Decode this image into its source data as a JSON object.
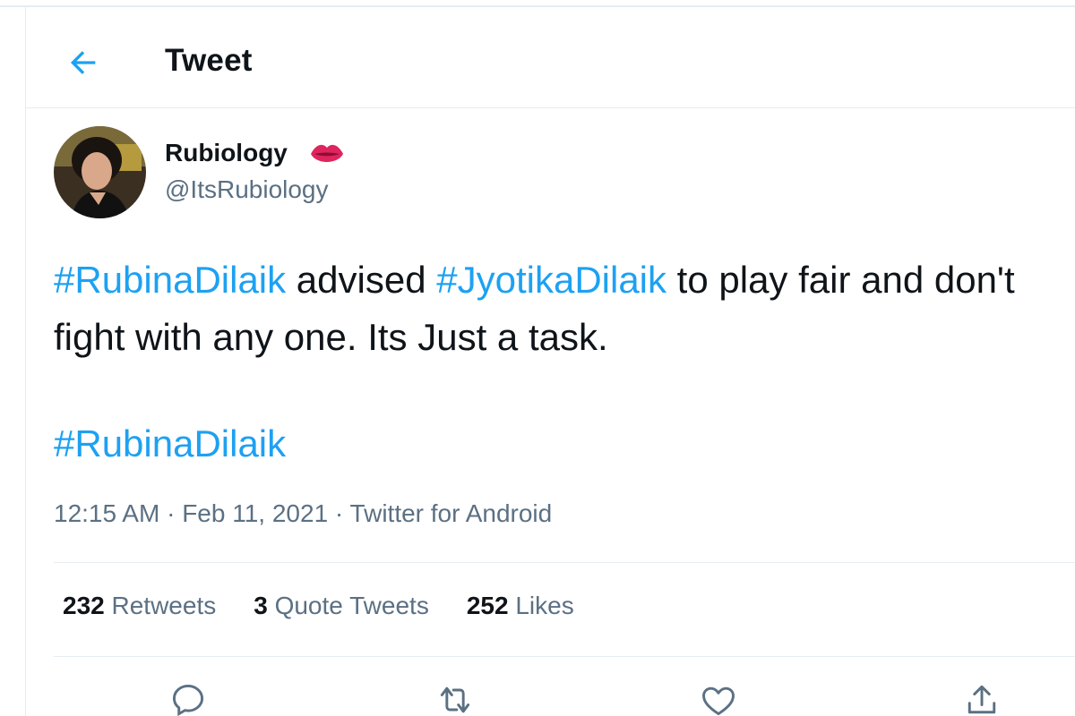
{
  "header": {
    "title": "Tweet"
  },
  "tweet": {
    "author_name": "Rubiology",
    "author_handle": "@ItsRubiology",
    "text": {
      "hashtag_1": "#RubinaDilaik",
      "part_1": " advised ",
      "hashtag_2": "#JyotikaDilaik",
      "part_2": " to play fair and don't fight with any one. Its Just a task.",
      "hashtag_3": "#RubinaDilaik"
    },
    "time": "12:15 AM",
    "date": "Feb 11, 2021",
    "separator": " · ",
    "source": "Twitter for Android"
  },
  "stats": {
    "retweets_count": "232",
    "retweets_label": "Retweets",
    "quotes_count": "3",
    "quotes_label": "Quote Tweets",
    "likes_count": "252",
    "likes_label": "Likes"
  },
  "icons": {
    "back": "arrow-left-icon",
    "lips": "lips-emoji-icon",
    "reply": "reply-icon",
    "retweet": "retweet-icon",
    "like": "heart-icon",
    "share": "share-icon"
  },
  "colors": {
    "accent": "#1da1f2",
    "text": "#0f1419",
    "secondary": "#5b7083",
    "divider": "#e6ecf0",
    "lips": "#e0245e"
  }
}
